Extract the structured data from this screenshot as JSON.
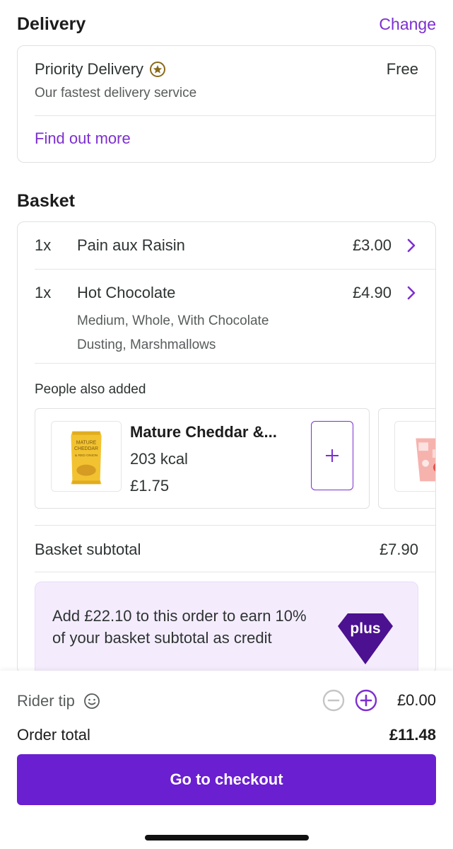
{
  "delivery": {
    "title": "Delivery",
    "change_label": "Change",
    "option_name": "Priority Delivery",
    "option_price": "Free",
    "option_desc": "Our fastest delivery service",
    "find_out_more": "Find out more"
  },
  "basket": {
    "title": "Basket",
    "items": [
      {
        "qty": "1x",
        "name": "Pain aux Raisin",
        "price": "£3.00",
        "mods": ""
      },
      {
        "qty": "1x",
        "name": "Hot Chocolate",
        "price": "£4.90",
        "mods": "Medium, Whole, With Chocolate Dusting, Marshmallows"
      }
    ],
    "people_also_added_label": "People also added",
    "recommendations": [
      {
        "name": "Mature Cheddar &...",
        "kcal": "203 kcal",
        "price": "£1.75",
        "image": "crisps-packet"
      },
      {
        "image": "pink-drink-glass"
      }
    ],
    "subtotal_label": "Basket subtotal",
    "subtotal_value": "£7.90",
    "plus_promo": "Add £22.10 to this order to earn 10% of your basket subtotal as credit",
    "plus_logo_text": "plus",
    "packet_label_lines": [
      "MATURE",
      "CHEDDAR",
      "& RED ONION"
    ]
  },
  "footer": {
    "tip_label": "Rider tip",
    "tip_amount": "£0.00",
    "order_total_label": "Order total",
    "order_total_value": "£11.48",
    "checkout_label": "Go to checkout"
  },
  "colors": {
    "accent": "#7d2fd0",
    "button": "#6a1fd0",
    "promo_bg": "#f4ecfd",
    "plus_logo": "#4b1190",
    "star_badge": "#8a6a1a"
  }
}
